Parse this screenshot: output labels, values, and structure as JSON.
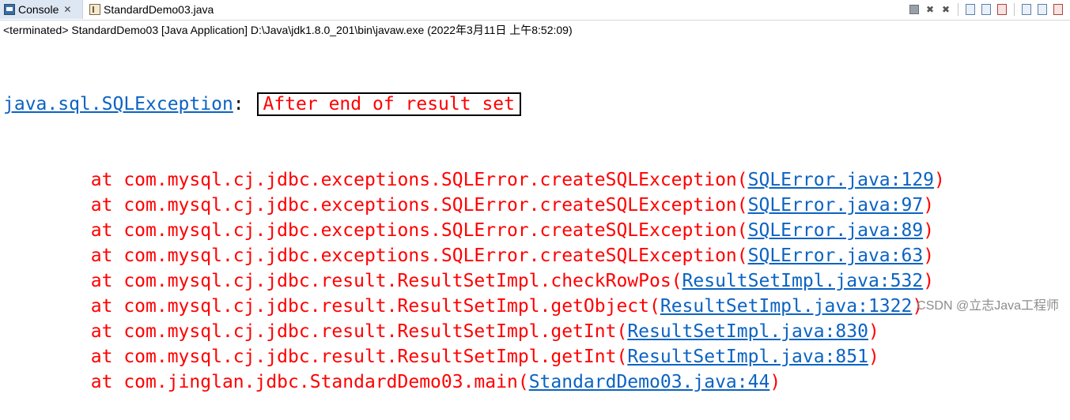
{
  "tabs": {
    "console_label": "Console",
    "close_glyph": "✕",
    "editor_label": "StandardDemo03.java"
  },
  "toolbar": {
    "icons": [
      "terminate-icon",
      "remove-launch-icon",
      "remove-all-icon",
      "scroll-lock-icon",
      "show-stdout-icon",
      "show-stderr-icon",
      "pin-console-icon",
      "display-selected-console-icon",
      "open-console-icon"
    ]
  },
  "status": {
    "terminated_line": "<terminated> StandardDemo03 [Java Application] D:\\Java\\jdk1.8.0_201\\bin\\javaw.exe (2022年3月11日 上午8:52:09)"
  },
  "exception": {
    "type": "java.sql.SQLException",
    "separator": ": ",
    "message": "After end of result set"
  },
  "stack": [
    {
      "prefix": "\tat com.mysql.cj.jdbc.exceptions.SQLError.createSQLException",
      "link": "SQLError.java:129"
    },
    {
      "prefix": "\tat com.mysql.cj.jdbc.exceptions.SQLError.createSQLException",
      "link": "SQLError.java:97"
    },
    {
      "prefix": "\tat com.mysql.cj.jdbc.exceptions.SQLError.createSQLException",
      "link": "SQLError.java:89"
    },
    {
      "prefix": "\tat com.mysql.cj.jdbc.exceptions.SQLError.createSQLException",
      "link": "SQLError.java:63"
    },
    {
      "prefix": "\tat com.mysql.cj.jdbc.result.ResultSetImpl.checkRowPos",
      "link": "ResultSetImpl.java:532"
    },
    {
      "prefix": "\tat com.mysql.cj.jdbc.result.ResultSetImpl.getObject",
      "link": "ResultSetImpl.java:1322"
    },
    {
      "prefix": "\tat com.mysql.cj.jdbc.result.ResultSetImpl.getInt",
      "link": "ResultSetImpl.java:830"
    },
    {
      "prefix": "\tat com.mysql.cj.jdbc.result.ResultSetImpl.getInt",
      "link": "ResultSetImpl.java:851"
    },
    {
      "prefix": "\tat com.jinglan.jdbc.StandardDemo03.main",
      "link": "StandardDemo03.java:44"
    }
  ],
  "colors": {
    "link": "#0b63c3",
    "error": "#ff0000",
    "tab_active": "#dde7f3"
  },
  "watermark": "CSDN @立志Java工程师"
}
